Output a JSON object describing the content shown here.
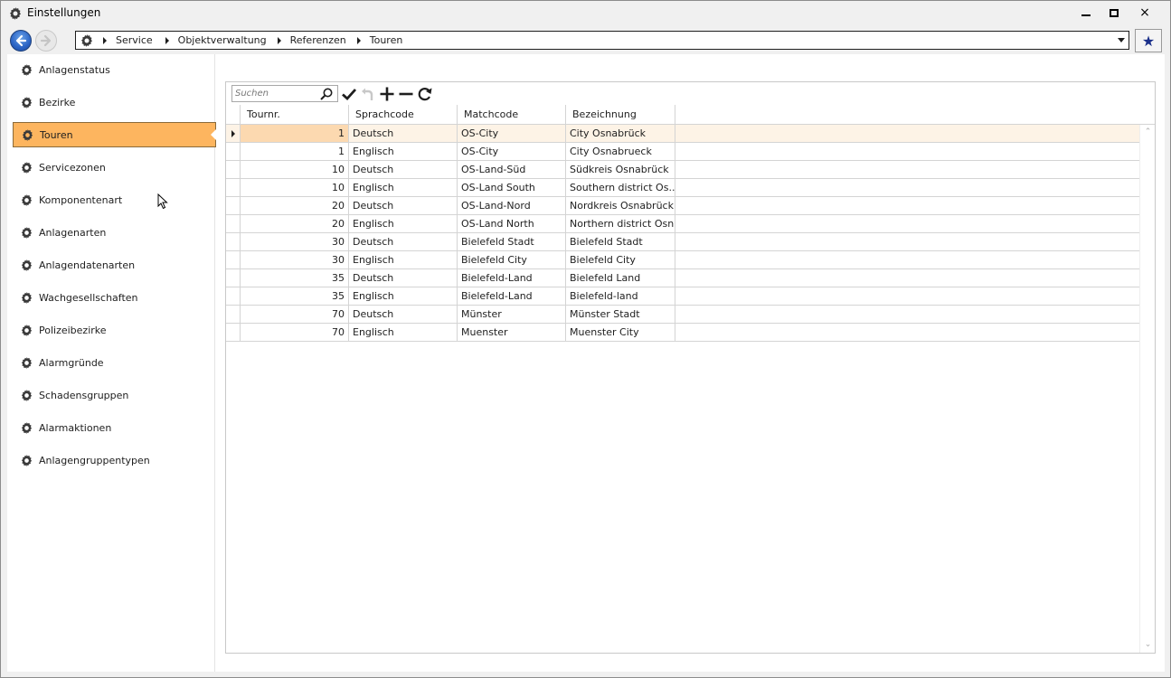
{
  "window": {
    "title": "Einstellungen",
    "icon": "gear-icon",
    "controls": {
      "minimize": "minimize-icon",
      "maximize": "maximize-icon",
      "close": "×"
    }
  },
  "navbar": {
    "back_icon": "back-arrow-icon",
    "forward_icon": "forward-arrow-icon",
    "breadcrumb": [
      "Service",
      "Objektverwaltung",
      "Referenzen",
      "Touren"
    ],
    "favorite_icon": "★"
  },
  "sidebar": {
    "items": [
      {
        "label": "Anlagenstatus"
      },
      {
        "label": "Bezirke"
      },
      {
        "label": "Touren",
        "selected": true
      },
      {
        "label": "Servicezonen"
      },
      {
        "label": "Komponentenart"
      },
      {
        "label": "Anlagenarten"
      },
      {
        "label": "Anlagendatenarten"
      },
      {
        "label": "Wachgesellschaften"
      },
      {
        "label": "Polizeibezirke"
      },
      {
        "label": "Alarmgründe"
      },
      {
        "label": "Schadensgruppen"
      },
      {
        "label": "Alarmaktionen"
      },
      {
        "label": "Anlagengruppentypen"
      }
    ]
  },
  "toolbar": {
    "search_placeholder": "Suchen",
    "buttons": [
      "check-icon",
      "undo-icon",
      "add-icon",
      "remove-icon",
      "refresh-icon"
    ]
  },
  "table": {
    "columns": [
      "Tournr.",
      "Sprachcode",
      "Matchcode",
      "Bezeichnung"
    ],
    "rows": [
      [
        "1",
        "Deutsch",
        "OS-City",
        "City Osnabrück"
      ],
      [
        "1",
        "Englisch",
        "OS-City",
        "City Osnabrueck"
      ],
      [
        "10",
        "Deutsch",
        "OS-Land-Süd",
        "Südkreis Osnabrück"
      ],
      [
        "10",
        "Englisch",
        "OS-Land South",
        "Southern district  Os..."
      ],
      [
        "20",
        "Deutsch",
        "OS-Land-Nord",
        "Nordkreis Osnabrück"
      ],
      [
        "20",
        "Englisch",
        "OS-Land North",
        "Northern district Osn..."
      ],
      [
        "30",
        "Deutsch",
        "Bielefeld Stadt",
        "Bielefeld Stadt"
      ],
      [
        "30",
        "Englisch",
        "Bielefeld City",
        "Bielefeld City"
      ],
      [
        "35",
        "Deutsch",
        "Bielefeld-Land",
        "Bielefeld Land"
      ],
      [
        "35",
        "Englisch",
        "Bielefeld-Land",
        "Bielefeld-land"
      ],
      [
        "70",
        "Deutsch",
        "Münster",
        "Münster Stadt"
      ],
      [
        "70",
        "Englisch",
        "Muenster",
        "Muenster City"
      ]
    ],
    "current_row": 0
  },
  "colors": {
    "selected_sidebar": "#fdb55f",
    "current_row": "#fdf3e6",
    "current_cell": "#fcd9b0",
    "back_button": "#2a63c4",
    "favorite": "#1a2f8a"
  }
}
